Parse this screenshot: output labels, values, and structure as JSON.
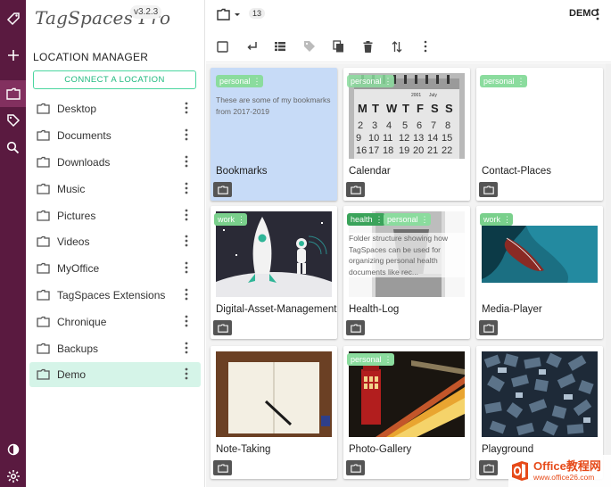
{
  "app": {
    "name": "TagSpaces Pro",
    "version": "v3.2.3"
  },
  "rail": {
    "icons": [
      "tag-logo-icon",
      "plus-icon",
      "folder-icon",
      "tags-icon",
      "search-icon",
      "theme-toggle-icon",
      "settings-icon"
    ]
  },
  "location_manager": {
    "title": "LOCATION MANAGER",
    "connect_label": "CONNECT A LOCATION",
    "locations": [
      {
        "name": "Desktop"
      },
      {
        "name": "Documents"
      },
      {
        "name": "Downloads"
      },
      {
        "name": "Music"
      },
      {
        "name": "Pictures"
      },
      {
        "name": "Videos"
      },
      {
        "name": "MyOffice"
      },
      {
        "name": "TagSpaces Extensions"
      },
      {
        "name": "Chronique"
      },
      {
        "name": "Backups"
      },
      {
        "name": "Demo",
        "selected": true
      }
    ]
  },
  "toolbar": {
    "item_count": "13",
    "location_label": "DEMO"
  },
  "grid": {
    "cards": [
      {
        "name": "Bookmarks",
        "tags": [
          "personal"
        ],
        "desc": "These are some of my bookmarks from 2017-2019",
        "selected": true
      },
      {
        "name": "Calendar",
        "tags": [
          "personal"
        ]
      },
      {
        "name": "Contact-Places",
        "tags": [
          "personal"
        ]
      },
      {
        "name": "Digital-Asset-Management",
        "tags": [
          "work"
        ]
      },
      {
        "name": "Health-Log",
        "tags": [
          "health",
          "personal"
        ],
        "desc": "Folder structure showing how TagSpaces can be used for organizing personal health documents like rec..."
      },
      {
        "name": "Media-Player",
        "tags": [
          "work"
        ]
      },
      {
        "name": "Note-Taking",
        "tags": []
      },
      {
        "name": "Photo-Gallery",
        "tags": [
          "personal"
        ]
      },
      {
        "name": "Playground",
        "tags": []
      }
    ]
  },
  "calendar": {
    "month": "July",
    "year": "2001",
    "weekdays": [
      "M",
      "T",
      "W",
      "T",
      "F",
      "S",
      "S"
    ],
    "rows": [
      [
        "2",
        "3",
        "4",
        "5",
        "6",
        "7",
        "8"
      ],
      [
        "9",
        "10",
        "11",
        "12",
        "13",
        "14",
        "15"
      ],
      [
        "16",
        "17",
        "18",
        "19",
        "20",
        "21",
        "22"
      ]
    ]
  },
  "colors": {
    "rail": "#5a1a40",
    "accent": "#1fb97e",
    "tag_personal": "#8bdc9e",
    "tag_work": "#7ad08c",
    "tag_health": "#3aa35a",
    "selected_card": "#c7dbf7"
  },
  "watermark": {
    "text": "Office教程网",
    "url": "www.office26.com"
  }
}
